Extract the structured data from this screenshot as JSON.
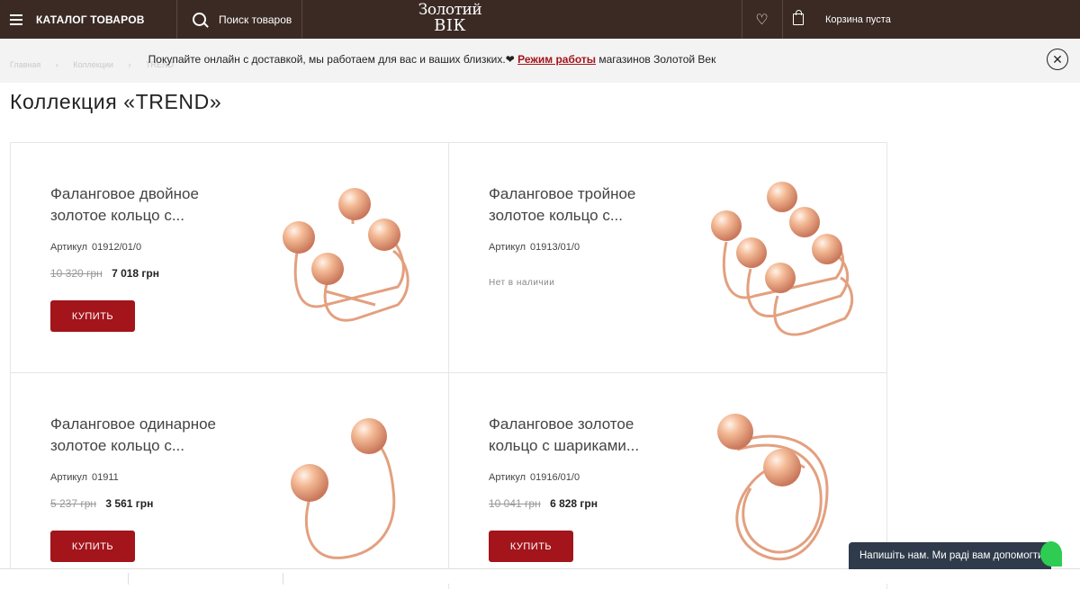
{
  "header": {
    "catalog_label": "КАТАЛОГ ТОВАРОВ",
    "search_label": "Поиск товаров",
    "logo_top": "Золотий",
    "logo_bottom": "ВІК",
    "cart_label": "Корзина пуста"
  },
  "notice": {
    "breadcrumbs": "Главная › Коллекции › TREND",
    "text_before": "Покупайте онлайн с доставкой, мы работаем для вас и ваших близких.",
    "heart": "❤",
    "link_text": "Режим работы",
    "text_after": " магазинов Золотой Век",
    "close_symbol": "✕"
  },
  "page_title": "Коллекция «TREND»",
  "labels": {
    "article": "Артикул",
    "buy": "КУПИТЬ"
  },
  "products": [
    {
      "name": "Фаланговое двойное золотое кольцо с...",
      "article": "01912/01/0",
      "old_price": "10 320 грн",
      "price": "7 018 грн",
      "stock": ""
    },
    {
      "name": "Фаланговое тройное золотое кольцо с...",
      "article": "01913/01/0",
      "old_price": "",
      "price": "",
      "stock": "Нет в наличии"
    },
    {
      "name": "Фаланговое одинарное золотое кольцо с...",
      "article": "01911",
      "old_price": "5 237 грн",
      "price": "3 561 грн",
      "stock": ""
    },
    {
      "name": "Фаланговое золотое кольцо с шариками...",
      "article": "01916/01/0",
      "old_price": "10 041 грн",
      "price": "6 828 грн",
      "stock": ""
    }
  ],
  "chat": {
    "label": "Напишіть нам. Ми раді вам допомогти!"
  },
  "colors": {
    "header_bg": "#3b2a24",
    "accent": "#a3141b",
    "gold": "#f0b48f"
  }
}
